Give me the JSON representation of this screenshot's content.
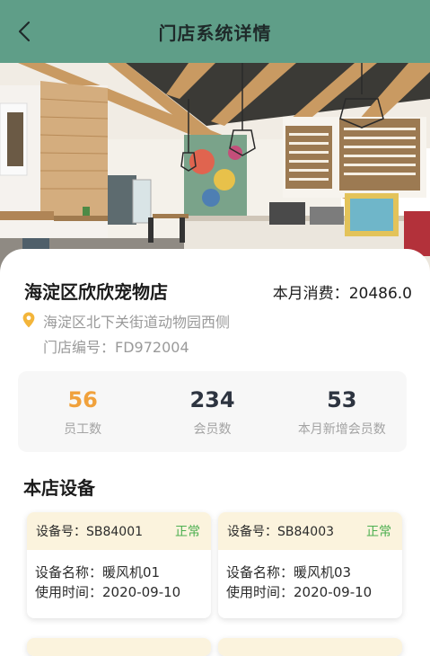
{
  "header": {
    "title": "门店系统详情"
  },
  "store": {
    "name": "海淀区欣欣宠物店",
    "monthly_label": "本月消费：",
    "monthly_value": "20486.0",
    "address": "海淀区北下关街道动物园西侧",
    "code_label": "门店编号：",
    "code_value": "FD972004"
  },
  "stats": [
    {
      "value": "56",
      "label": "员工数"
    },
    {
      "value": "234",
      "label": "会员数"
    },
    {
      "value": "53",
      "label": "本月新增会员数"
    }
  ],
  "devices_section": {
    "title": "本店设备"
  },
  "devices": [
    {
      "id_label": "设备号：",
      "id": "SB84001",
      "status": "正常",
      "name_label": "设备名称：",
      "name": "暖风机01",
      "time_label": "使用时间：",
      "time": "2020-09-10"
    },
    {
      "id_label": "设备号：",
      "id": "SB84003",
      "status": "正常",
      "name_label": "设备名称：",
      "name": "暖风机03",
      "time_label": "使用时间：",
      "time": "2020-09-10"
    }
  ],
  "colors": {
    "header": "#5f9e88",
    "accent": "#f0a13c",
    "status_ok": "#4caf50",
    "device_head": "#fbf3dd"
  },
  "icons": {
    "back": "chevron-left-icon",
    "location": "location-pin-icon"
  }
}
